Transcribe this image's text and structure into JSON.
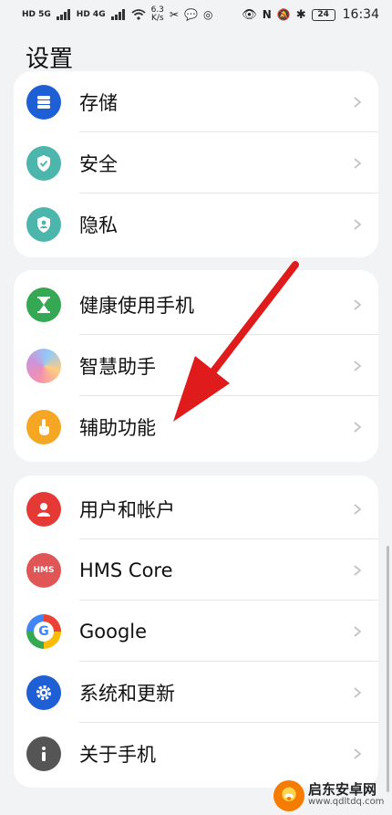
{
  "status_bar": {
    "left_badges": [
      "HD 5G",
      "HD 4G"
    ],
    "net_speed": "6.3",
    "net_unit": "K/s",
    "battery": "24",
    "time": "16:34"
  },
  "page": {
    "title": "设置"
  },
  "groups": [
    {
      "items": [
        {
          "label": "存储",
          "icon": "storage-icon",
          "color": "#1e5fd6"
        },
        {
          "label": "安全",
          "icon": "shield-check-icon",
          "color": "#4db6ac"
        },
        {
          "label": "隐私",
          "icon": "privacy-shield-icon",
          "color": "#4db6ac"
        }
      ]
    },
    {
      "items": [
        {
          "label": "健康使用手机",
          "icon": "hourglass-icon",
          "color": "#34a853"
        },
        {
          "label": "智慧助手",
          "icon": "assistant-orb-icon",
          "color": "#b39ddb"
        },
        {
          "label": "辅助功能",
          "icon": "hand-touch-icon",
          "color": "#f5a623"
        }
      ]
    },
    {
      "items": [
        {
          "label": "用户和帐户",
          "icon": "user-icon",
          "color": "#e53935"
        },
        {
          "label": "HMS Core",
          "icon": "hms-icon",
          "color": "#e05555",
          "icon_text": "HMS"
        },
        {
          "label": "Google",
          "icon": "google-icon",
          "color": "#ffffff"
        },
        {
          "label": "系统和更新",
          "icon": "gear-icon",
          "color": "#1e5fd6"
        },
        {
          "label": "关于手机",
          "icon": "info-icon",
          "color": "#555555"
        }
      ]
    }
  ],
  "watermark": {
    "title": "启东安卓网",
    "url": "www.qdltdq.com"
  },
  "colors": {
    "arrow": "#e01b1b",
    "background": "#f1f3f5",
    "card": "#ffffff"
  }
}
